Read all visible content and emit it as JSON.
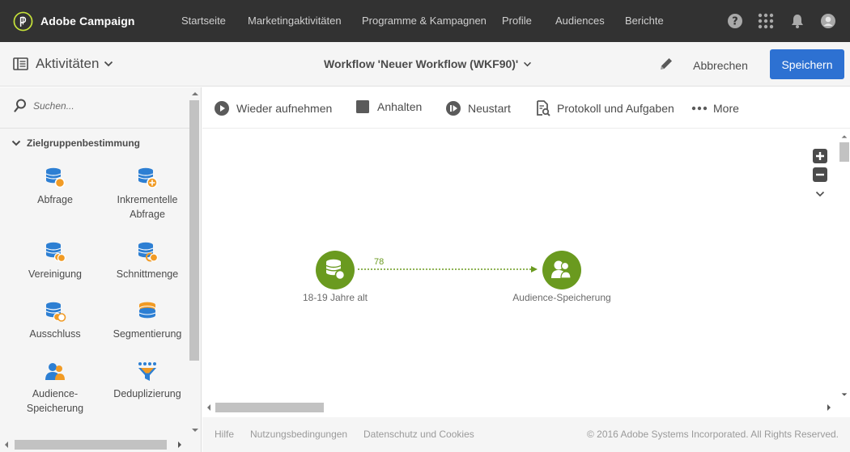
{
  "app": {
    "name": "Adobe Campaign"
  },
  "nav": {
    "items": [
      "Startseite",
      "Marketingaktivitäten",
      "Programme & Kampagnen",
      "Profile",
      "Audiences",
      "Berichte"
    ],
    "icons": [
      "help-icon",
      "apps-grid-icon",
      "bell-icon",
      "user-avatar-icon"
    ]
  },
  "header": {
    "activities_label": "Aktivitäten",
    "workflow_title": "Workflow 'Neuer Workflow (WKF90)'",
    "cancel_label": "Abbrechen",
    "save_label": "Speichern"
  },
  "palette": {
    "search_placeholder": "Suchen...",
    "group_title": "Zielgruppenbestimmung",
    "activities": [
      {
        "label": "Abfrage",
        "icon": "query-icon"
      },
      {
        "label": "Inkrementelle Abfrage",
        "icon": "incremental-query-icon"
      },
      {
        "label": "Vereinigung",
        "icon": "union-icon"
      },
      {
        "label": "Schnittmenge",
        "icon": "intersection-icon"
      },
      {
        "label": "Ausschluss",
        "icon": "exclusion-icon"
      },
      {
        "label": "Segmentierung",
        "icon": "segmentation-icon"
      },
      {
        "label": "Audience-Speicherung",
        "icon": "save-audience-icon"
      },
      {
        "label": "Deduplizierung",
        "icon": "deduplication-icon"
      }
    ]
  },
  "toolbar": {
    "resume_label": "Wieder aufnehmen",
    "stop_label": "Anhalten",
    "restart_label": "Neustart",
    "log_label": "Protokoll und Aufgaben",
    "more_label": "More"
  },
  "canvas": {
    "nodes": [
      {
        "label": "18-19 Jahre alt",
        "icon": "query-icon"
      },
      {
        "label": "Audience-Speicherung",
        "icon": "save-audience-icon"
      }
    ],
    "transition_count": "78"
  },
  "footer": {
    "links": [
      "Hilfe",
      "Nutzungsbedingungen",
      "Datenschutz und Cookies"
    ],
    "copyright": "© 2016 Adobe Systems Incorporated. All Rights Reserved."
  },
  "colors": {
    "topbar": "#323232",
    "accent_blue": "#2d71d2",
    "node_green": "#6a9a1f",
    "icon_blue": "#2d7fd3",
    "icon_orange": "#f19b25"
  }
}
